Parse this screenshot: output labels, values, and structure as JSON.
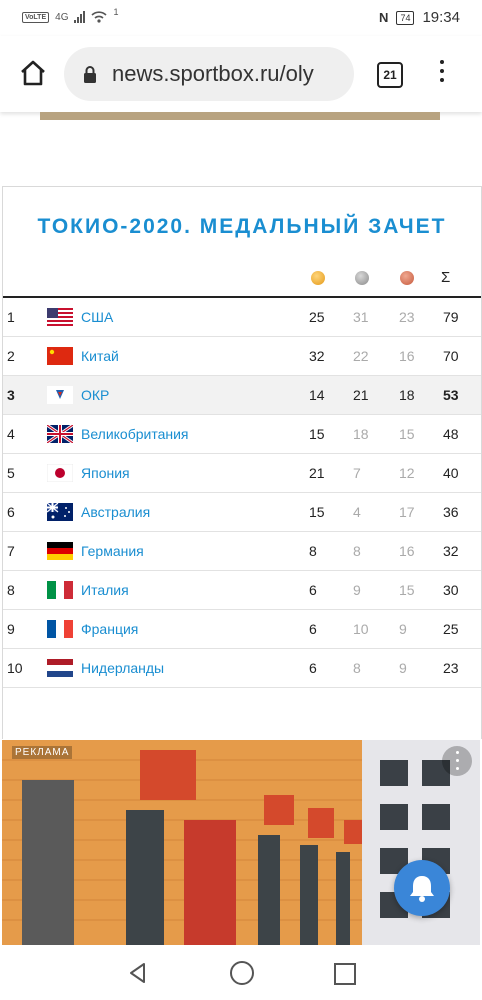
{
  "status_bar": {
    "network": "VoLTE",
    "signal_type": "4G",
    "wifi_count": "1",
    "battery": "74",
    "time": "19:34"
  },
  "browser": {
    "url": "news.sportbox.ru/oly",
    "tab_count": "21"
  },
  "medals_table": {
    "title": "ТОКИО-2020. МЕДАЛЬНЫЙ ЗАЧЕТ",
    "total_symbol": "Σ",
    "medal_icons": [
      "gold-medal-icon",
      "silver-medal-icon",
      "bronze-medal-icon"
    ],
    "rows": [
      {
        "rank": "1",
        "flag": "usa-flag-icon",
        "country": "США",
        "gold": "25",
        "silver": "31",
        "bronze": "23",
        "total": "79"
      },
      {
        "rank": "2",
        "flag": "china-flag-icon",
        "country": "Китай",
        "gold": "32",
        "silver": "22",
        "bronze": "16",
        "total": "70"
      },
      {
        "rank": "3",
        "flag": "roc-flag-icon",
        "country": "ОКР",
        "gold": "14",
        "silver": "21",
        "bronze": "18",
        "total": "53"
      },
      {
        "rank": "4",
        "flag": "uk-flag-icon",
        "country": "Великобритания",
        "gold": "15",
        "silver": "18",
        "bronze": "15",
        "total": "48"
      },
      {
        "rank": "5",
        "flag": "japan-flag-icon",
        "country": "Япония",
        "gold": "21",
        "silver": "7",
        "bronze": "12",
        "total": "40"
      },
      {
        "rank": "6",
        "flag": "australia-flag-icon",
        "country": "Австралия",
        "gold": "15",
        "silver": "4",
        "bronze": "17",
        "total": "36"
      },
      {
        "rank": "7",
        "flag": "germany-flag-icon",
        "country": "Германия",
        "gold": "8",
        "silver": "8",
        "bronze": "16",
        "total": "32"
      },
      {
        "rank": "8",
        "flag": "italy-flag-icon",
        "country": "Италия",
        "gold": "6",
        "silver": "9",
        "bronze": "15",
        "total": "30"
      },
      {
        "rank": "9",
        "flag": "france-flag-icon",
        "country": "Франция",
        "gold": "6",
        "silver": "10",
        "bronze": "9",
        "total": "25"
      },
      {
        "rank": "10",
        "flag": "netherlands-flag-icon",
        "country": "Нидерланды",
        "gold": "6",
        "silver": "8",
        "bronze": "9",
        "total": "23"
      }
    ]
  },
  "ad": {
    "label": "РЕКЛАМА"
  },
  "colors": {
    "accent": "#1a8ed1",
    "highlight_row": "#f2f2f2",
    "bell_button": "#3a86d8"
  }
}
